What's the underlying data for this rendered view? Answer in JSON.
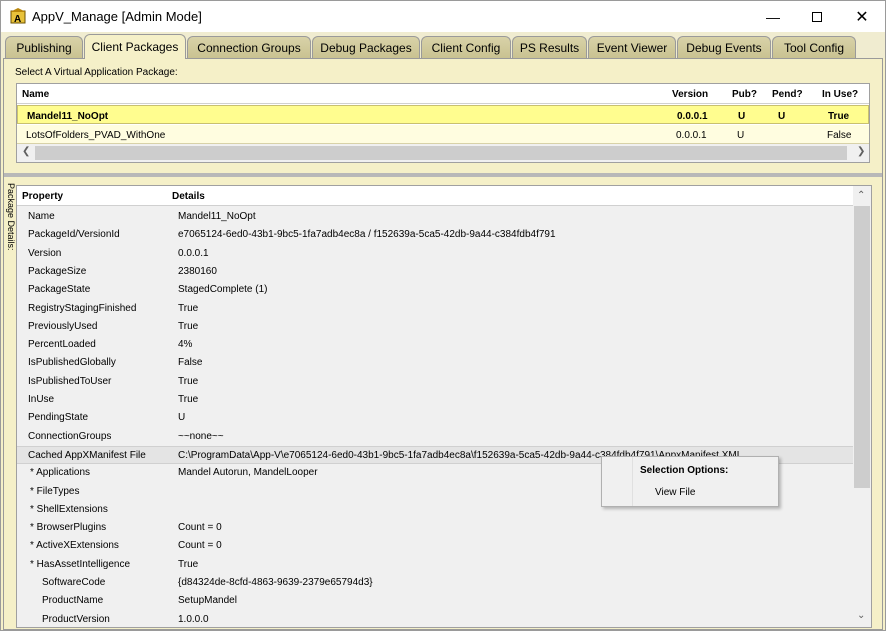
{
  "window": {
    "title": "AppV_Manage [Admin Mode]"
  },
  "tabs": [
    {
      "label": "Publishing"
    },
    {
      "label": "Client Packages"
    },
    {
      "label": "Connection Groups"
    },
    {
      "label": "Debug Packages"
    },
    {
      "label": "Client Config"
    },
    {
      "label": "PS Results"
    },
    {
      "label": "Event Viewer"
    },
    {
      "label": "Debug Events"
    },
    {
      "label": "Tool Config"
    }
  ],
  "active_tab": "Client Packages",
  "packages": {
    "label": "Select A Virtual Application Package:",
    "columns": {
      "name": "Name",
      "version": "Version",
      "pub": "Pub?",
      "pend": "Pend?",
      "inuse": "In Use?"
    },
    "rows": [
      {
        "name": "Mandel11_NoOpt",
        "version": "0.0.0.1",
        "pub": "U",
        "pend": "U",
        "inuse": "True"
      },
      {
        "name": "LotsOfFolders_PVAD_WithOne",
        "version": "0.0.0.1",
        "pub": "U",
        "pend": "",
        "inuse": "False"
      }
    ]
  },
  "details": {
    "side_label": "Package Details:",
    "columns": {
      "property": "Property",
      "details": "Details"
    },
    "rows": [
      {
        "property": "Name",
        "value": "Mandel11_NoOpt"
      },
      {
        "property": "PackageId/VersionId",
        "value": "e7065124-6ed0-43b1-9bc5-1fa7adb4ec8a / f152639a-5ca5-42db-9a44-c384fdb4f791"
      },
      {
        "property": "Version",
        "value": "0.0.0.1"
      },
      {
        "property": "PackageSize",
        "value": "2380160"
      },
      {
        "property": "PackageState",
        "value": "StagedComplete (1)"
      },
      {
        "property": "RegistryStagingFinished",
        "value": "True"
      },
      {
        "property": "PreviouslyUsed",
        "value": "True"
      },
      {
        "property": "PercentLoaded",
        "value": "4%"
      },
      {
        "property": "IsPublishedGlobally",
        "value": "False"
      },
      {
        "property": "IsPublishedToUser",
        "value": "True"
      },
      {
        "property": "InUse",
        "value": "True"
      },
      {
        "property": "PendingState",
        "value": "U"
      },
      {
        "property": "ConnectionGroups",
        "value": "~~none~~"
      },
      {
        "property": "Cached AppXManifest File",
        "value": "C:\\ProgramData\\App-V\\e7065124-6ed0-43b1-9bc5-1fa7adb4ec8a\\f152639a-5ca5-42db-9a44-c384fdb4f791\\AppxManifest.XML"
      },
      {
        "property": "* Applications",
        "value": "Mandel Autorun, MandelLooper"
      },
      {
        "property": "* FileTypes",
        "value": ""
      },
      {
        "property": "* ShellExtensions",
        "value": ""
      },
      {
        "property": "* BrowserPlugins",
        "value": "Count = 0"
      },
      {
        "property": "* ActiveXExtensions",
        "value": "Count = 0"
      },
      {
        "property": "* HasAssetIntelligence",
        "value": "True"
      },
      {
        "property": "SoftwareCode",
        "value": "{d84324de-8cfd-4863-9639-2379e65794d3}"
      },
      {
        "property": "ProductName",
        "value": "SetupMandel"
      },
      {
        "property": "ProductVersion",
        "value": "1.0.0.0"
      }
    ]
  },
  "context_menu": {
    "title": "Selection Options:",
    "item": "View File"
  }
}
